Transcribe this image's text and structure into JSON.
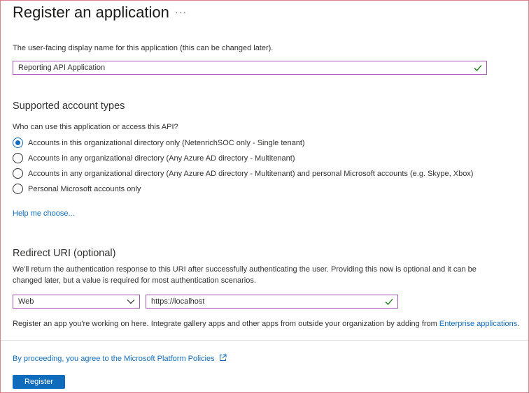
{
  "header": {
    "title": "Register an application",
    "more_label": "···"
  },
  "name_section": {
    "description": "The user-facing display name for this application (this can be changed later).",
    "value": "Reporting API Application"
  },
  "account_types": {
    "heading": "Supported account types",
    "question": "Who can use this application or access this API?",
    "options": [
      {
        "label": "Accounts in this organizational directory only (NetenrichSOC only - Single tenant)",
        "selected": true
      },
      {
        "label": "Accounts in any organizational directory (Any Azure AD directory - Multitenant)",
        "selected": false
      },
      {
        "label": "Accounts in any organizational directory (Any Azure AD directory - Multitenant) and personal Microsoft accounts (e.g. Skype, Xbox)",
        "selected": false
      },
      {
        "label": "Personal Microsoft accounts only",
        "selected": false
      }
    ],
    "help_link": "Help me choose..."
  },
  "redirect": {
    "heading": "Redirect URI (optional)",
    "description_line1": "We'll return the authentication response to this URI after successfully authenticating the user. Providing this now is optional and it can be",
    "description_line2": "changed later, but a value is required for most authentication scenarios.",
    "platform_value": "Web",
    "uri_value": "https://localhost",
    "register_note": "Register an app you're working on here. Integrate gallery apps and other apps from outside your organization by adding from",
    "enterprise_link": "Enterprise applications",
    "register_note_end": "."
  },
  "footer": {
    "policy_text": "By proceeding, you agree to the Microsoft Platform Policies",
    "register_button": "Register"
  },
  "colors": {
    "accent": "#0f6cbd",
    "input_border": "#a84fb8",
    "check_green": "#107c10",
    "frame_border": "#d9828a"
  },
  "icons": {
    "valid": "checkmark-icon",
    "dropdown": "chevron-down-icon",
    "external": "external-link-icon"
  }
}
